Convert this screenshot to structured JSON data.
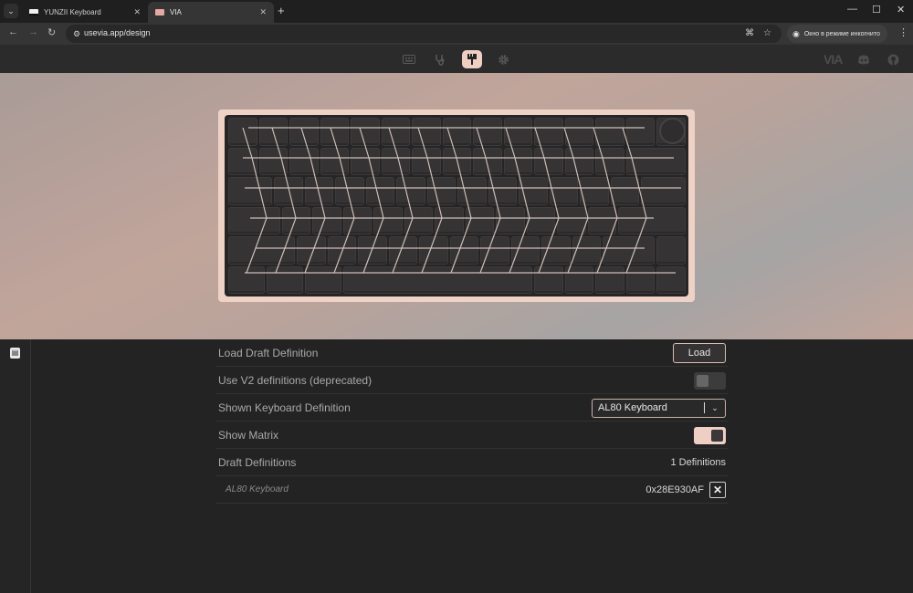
{
  "browser": {
    "tabs": [
      {
        "label": "YUNZII Keyboard",
        "active": false
      },
      {
        "label": "VIA",
        "active": true
      }
    ],
    "url": "usevia.app/design",
    "incognito_label": "Окно в режиме инкогнито"
  },
  "via_header": {
    "icons": [
      "keyboard-icon",
      "stethoscope-icon",
      "brush-icon",
      "gear-icon"
    ],
    "active_icon": "brush-icon",
    "logo": "VIA"
  },
  "colors": {
    "accent": "#efcfc4",
    "background": "#242323"
  },
  "settings": {
    "load_draft": {
      "label": "Load Draft Definition",
      "button": "Load"
    },
    "use_v2": {
      "label": "Use V2 definitions (deprecated)",
      "enabled": false
    },
    "shown_definition": {
      "label": "Shown Keyboard Definition",
      "value": "AL80 Keyboard"
    },
    "show_matrix": {
      "label": "Show Matrix",
      "enabled": true
    },
    "draft_definitions": {
      "label": "Draft Definitions",
      "count": "1 Definitions"
    },
    "drafts": [
      {
        "name": "AL80 Keyboard",
        "id": "0x28E930AF"
      }
    ]
  }
}
